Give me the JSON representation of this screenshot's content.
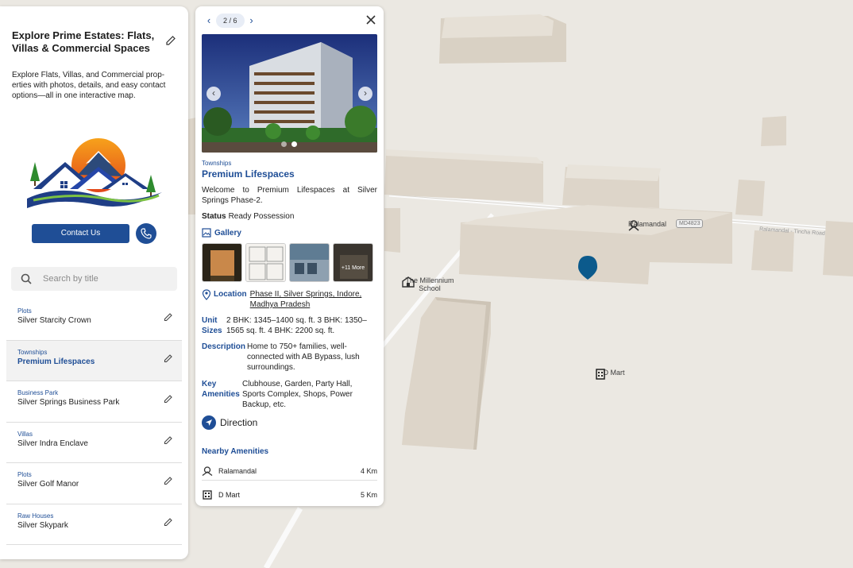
{
  "sidebar": {
    "title": "Explore Prime Estates: Flats, Villas & Commercial Spaces",
    "description": "Explore Flats, Villas, and Commercial prop-erties with photos, details, and easy contact options—all in one interactive map.",
    "contact_label": "Contact Us",
    "search_placeholder": "Search by title",
    "items": [
      {
        "category": "Plots",
        "name": "Silver Starcity Crown"
      },
      {
        "category": "Townships",
        "name": "Premium Lifespaces"
      },
      {
        "category": "Business Park",
        "name": "Silver Springs Business Park"
      },
      {
        "category": "Villas",
        "name": "Silver Indra Enclave"
      },
      {
        "category": "Plots",
        "name": "Silver Golf Manor"
      },
      {
        "category": "Raw Houses",
        "name": "Silver Skypark"
      }
    ]
  },
  "card": {
    "pager": "2 / 6",
    "category": "Townships",
    "name": "Premium Lifespaces",
    "welcome": "Welcome to Premium Lifespaces at Silver Springs Phase-2.",
    "status_label": "Status",
    "status_value": "Ready Possession",
    "gallery_label": "Gallery",
    "more_label": "+11 More",
    "location_label": "Location",
    "location_value": "Phase II, Silver Springs, Indore, Madhya Pradesh",
    "unit_sizes_label": "Unit Sizes",
    "unit_sizes_value": "2 BHK: 1345–1400 sq. ft. 3 BHK: 1350–1565 sq. ft. 4 BHK: 2200 sq. ft.",
    "description_label": "Description",
    "description_value": "Home to 750+ families, well-connected with AB Bypass, lush surroundings.",
    "amenities_label": "Key Amenities",
    "amenities_value": "Clubhouse, Garden, Party Hall, Sports Complex, Shops, Power Backup, etc.",
    "direction_label": "Direction",
    "nearby_label": "Nearby Amenities",
    "nearby": [
      {
        "name": "Ralamandal",
        "distance": "4 Km",
        "icon": "park-icon"
      },
      {
        "name": "D Mart",
        "distance": "5 Km",
        "icon": "shopping-icon"
      }
    ]
  },
  "map": {
    "poi_ralamandal": "Ralamandal",
    "poi_school": "The Millennium School",
    "poi_dmart": "D Mart",
    "road_tag": "MD4823",
    "road_name": "Ralamandal - Tincha Road"
  },
  "colors": {
    "accent": "#1f4e96",
    "marker": "#0b5a8c"
  }
}
